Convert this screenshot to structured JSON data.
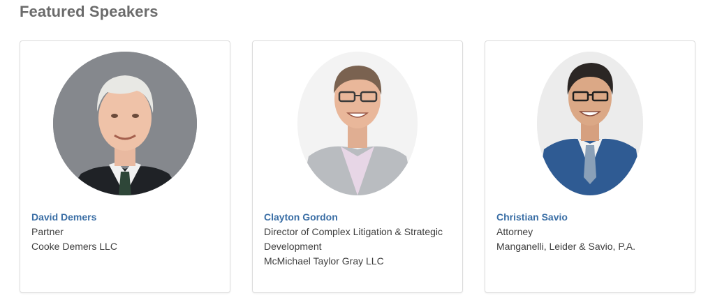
{
  "section": {
    "title": "Featured Speakers"
  },
  "speakers": [
    {
      "name": "David Demers",
      "title": "Partner",
      "company": "Cooke Demers LLC"
    },
    {
      "name": "Clayton Gordon",
      "title": "Director of Complex Litigation & Strategic Development",
      "company": "McMichael Taylor Gray LLC"
    },
    {
      "name": "Christian Savio",
      "title": "Attorney",
      "company": "Manganelli, Leider & Savio, P.A."
    }
  ]
}
